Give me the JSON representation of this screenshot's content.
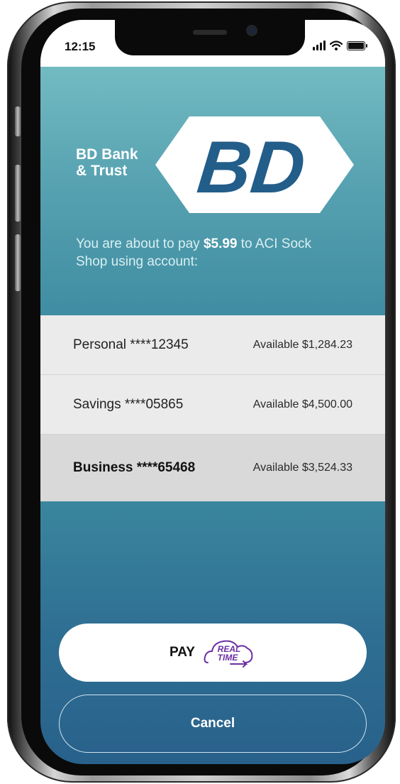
{
  "status_bar": {
    "time": "12:15"
  },
  "brand": {
    "bank_name_line1": "BD Bank",
    "bank_name_line2": "& Trust",
    "logo_text": "BD",
    "logo_color": "#235d8a"
  },
  "message": {
    "prefix": "You are about to pay",
    "amount": "$5.99",
    "suffix": "to ACI Sock Shop using account:"
  },
  "accounts": [
    {
      "name": "Personal ****12345",
      "balance": "Available $1,284.23",
      "selected": false
    },
    {
      "name": "Savings ****05865",
      "balance": "Available $4,500.00",
      "selected": false
    },
    {
      "name": "Business ****65468",
      "balance": "Available $3,524.33",
      "selected": true
    }
  ],
  "actions": {
    "pay_label": "PAY",
    "cancel_label": "Cancel"
  },
  "realtime_logo": {
    "line1": "REAL",
    "line2": "TIME",
    "color": "#6b2fa3"
  },
  "colors": {
    "gradient_top": "#7ec5c9",
    "gradient_bottom": "#28618b"
  }
}
